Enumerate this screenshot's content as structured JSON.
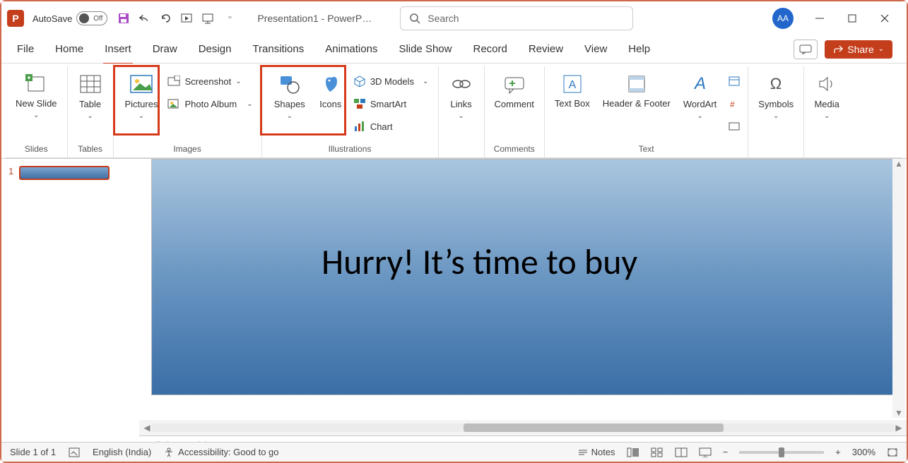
{
  "titlebar": {
    "autosave_label": "AutoSave",
    "autosave_state": "Off",
    "title": "Presentation1 - PowerP…",
    "search_placeholder": "Search",
    "avatar_initials": "AA"
  },
  "tabs": {
    "items": [
      "File",
      "Home",
      "Insert",
      "Draw",
      "Design",
      "Transitions",
      "Animations",
      "Slide Show",
      "Record",
      "Review",
      "View",
      "Help"
    ],
    "active_index": 2,
    "share_label": "Share"
  },
  "ribbon": {
    "new_slide": "New Slide",
    "table": "Table",
    "pictures": "Pictures",
    "screenshot": "Screenshot",
    "photo_album": "Photo Album",
    "shapes": "Shapes",
    "icons": "Icons",
    "models3d": "3D Models",
    "smartart": "SmartArt",
    "chart": "Chart",
    "links": "Links",
    "comment": "Comment",
    "textbox": "Text Box",
    "header_footer": "Header & Footer",
    "wordart": "WordArt",
    "symbols": "Symbols",
    "media": "Media",
    "groups": {
      "slides": "Slides",
      "tables": "Tables",
      "images": "Images",
      "illustrations": "Illustrations",
      "comments": "Comments",
      "text": "Text"
    }
  },
  "thumbnails": {
    "slide1_num": "1"
  },
  "slide": {
    "title_text": "Hurry! It’s time to buy"
  },
  "notes": {
    "placeholder": "Click to add notes"
  },
  "status": {
    "slide_info": "Slide 1 of 1",
    "language": "English (India)",
    "accessibility": "Accessibility: Good to go",
    "notes_btn": "Notes",
    "zoom_pct": "300%"
  }
}
